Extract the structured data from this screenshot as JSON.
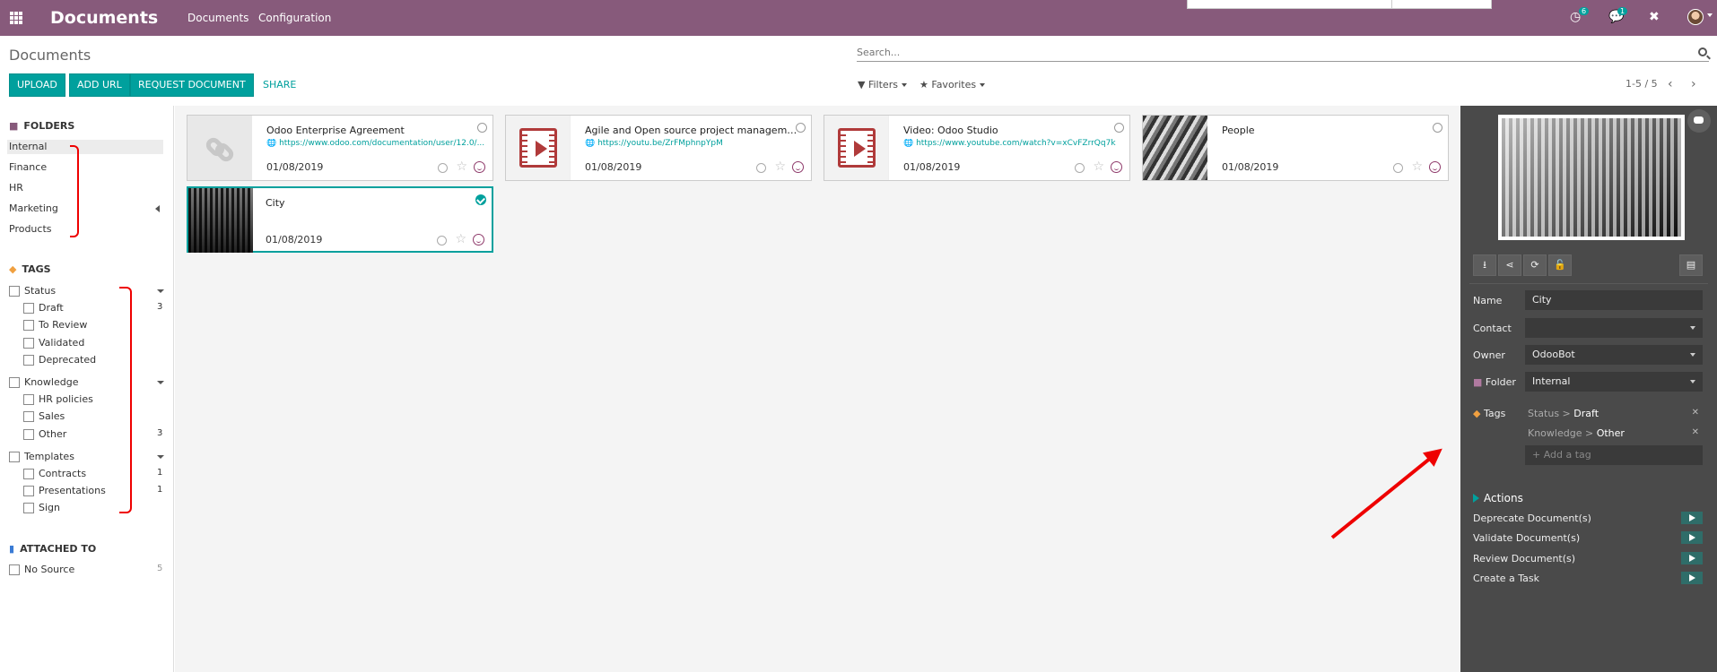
{
  "navbar": {
    "brand": "Documents",
    "menu": [
      "Documents",
      "Configuration"
    ],
    "activity_count": "6",
    "message_count": "1"
  },
  "control": {
    "title": "Documents",
    "search_placeholder": "Search...",
    "buttons": {
      "upload": "UPLOAD",
      "add_url": "ADD URL",
      "request": "REQUEST DOCUMENT",
      "share": "SHARE"
    },
    "filters": "Filters",
    "favorites": "Favorites",
    "pager": "1-5 / 5"
  },
  "sidebar": {
    "folders_title": "FOLDERS",
    "folders": [
      "Internal",
      "Finance",
      "HR",
      "Marketing",
      "Products"
    ],
    "tags_title": "TAGS",
    "groups": [
      {
        "name": "Status",
        "items": [
          {
            "name": "Draft",
            "count": "3"
          },
          {
            "name": "To Review",
            "count": ""
          },
          {
            "name": "Validated",
            "count": ""
          },
          {
            "name": "Deprecated",
            "count": ""
          }
        ]
      },
      {
        "name": "Knowledge",
        "items": [
          {
            "name": "HR policies",
            "count": ""
          },
          {
            "name": "Sales",
            "count": ""
          },
          {
            "name": "Other",
            "count": "3"
          }
        ]
      },
      {
        "name": "Templates",
        "items": [
          {
            "name": "Contracts",
            "count": "1"
          },
          {
            "name": "Presentations",
            "count": "1"
          },
          {
            "name": "Sign",
            "count": ""
          }
        ]
      }
    ],
    "attached_title": "ATTACHED TO",
    "attached": [
      {
        "name": "No Source",
        "count": "5"
      }
    ]
  },
  "cards": [
    {
      "title": "Odoo Enterprise Agreement",
      "url": "https://www.odoo.com/documentation/user/12.0/...",
      "date": "01/08/2019",
      "thumb": "link-icon",
      "selected": false
    },
    {
      "title": "Agile and Open source project manageme...",
      "url": "https://youtu.be/ZrFMphnpYpM",
      "date": "01/08/2019",
      "thumb": "video-icon",
      "selected": false
    },
    {
      "title": "Video: Odoo Studio",
      "url": "https://www.youtube.com/watch?v=xCvFZrrQq7k",
      "date": "01/08/2019",
      "thumb": "video-icon",
      "selected": false
    },
    {
      "title": "People",
      "url": "",
      "date": "01/08/2019",
      "thumb": "image",
      "selected": false
    },
    {
      "title": "City",
      "url": "",
      "date": "01/08/2019",
      "thumb": "image",
      "selected": true
    }
  ],
  "inspector": {
    "name_label": "Name",
    "name_value": "City",
    "contact_label": "Contact",
    "contact_value": "",
    "owner_label": "Owner",
    "owner_value": "OdooBot",
    "folder_label": "Folder",
    "folder_value": "Internal",
    "tags_label": "Tags",
    "tags": [
      {
        "group": "Status",
        "sep": " > ",
        "value": "Draft"
      },
      {
        "group": "Knowledge",
        "sep": " > ",
        "value": "Other"
      }
    ],
    "add_tag_placeholder": "+ Add a tag",
    "actions_title": "Actions",
    "actions": [
      "Deprecate Document(s)",
      "Validate Document(s)",
      "Review Document(s)",
      "Create a Task"
    ]
  },
  "colors": {
    "navbar": "#875a7b",
    "accent": "#00a09d",
    "inspector": "#4a4a4a",
    "annotation": "#ee0000"
  }
}
